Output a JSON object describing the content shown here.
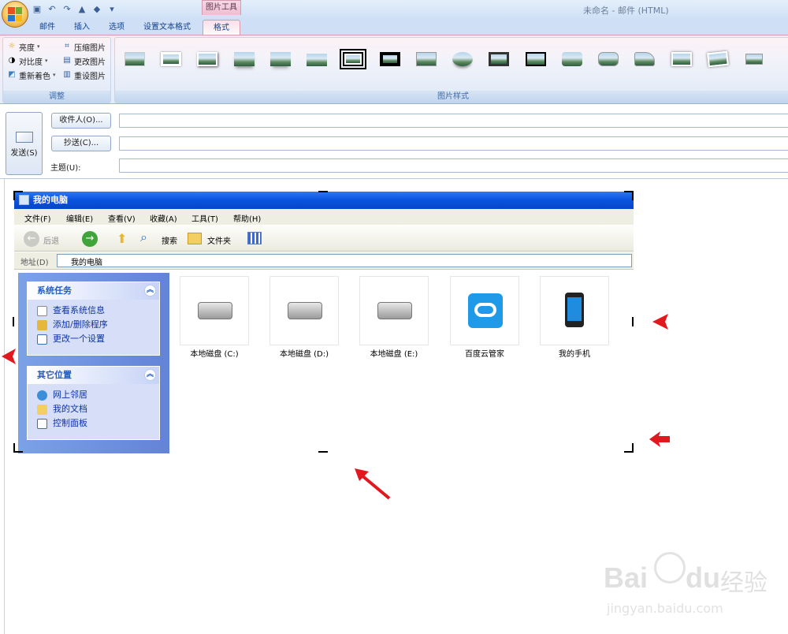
{
  "window": {
    "title": "未命名 - 邮件 (HTML)",
    "context_group": "图片工具"
  },
  "tabs": [
    "邮件",
    "插入",
    "选项",
    "设置文本格式",
    "格式"
  ],
  "ribbon": {
    "adjust": {
      "items": [
        "亮度",
        "对比度",
        "重新着色",
        "压缩图片",
        "更改图片",
        "重设图片"
      ],
      "label": "调整"
    },
    "styles": {
      "label": "图片样式"
    }
  },
  "compose": {
    "send_label": "发送(S)",
    "to_label": "收件人(O)...",
    "cc_label": "抄送(C)...",
    "subject_label": "主题(U):"
  },
  "explorer": {
    "title": "我的电脑",
    "menu": [
      "文件(F)",
      "编辑(E)",
      "查看(V)",
      "收藏(A)",
      "工具(T)",
      "帮助(H)"
    ],
    "toolbar": {
      "back": "后退",
      "search": "搜索",
      "folders": "文件夹"
    },
    "address_label": "地址(D)",
    "address_value": "我的电脑",
    "system_tasks": {
      "title": "系统任务",
      "items": [
        "查看系统信息",
        "添加/删除程序",
        "更改一个设置"
      ]
    },
    "other_places": {
      "title": "其它位置",
      "items": [
        "网上邻居",
        "我的文档",
        "控制面板"
      ]
    },
    "drives": [
      "本地磁盘 (C:)",
      "本地磁盘 (D:)",
      "本地磁盘 (E:)",
      "百度云管家",
      "我的手机"
    ]
  },
  "watermark": {
    "brand": "Bai",
    "brand2": "du",
    "suffix": "经验",
    "url": "jingyan.baidu.com"
  },
  "colors": {
    "accent_red": "#e3171e",
    "xp_blue": "#0a55e0",
    "ribbon_blue": "#15428b"
  }
}
